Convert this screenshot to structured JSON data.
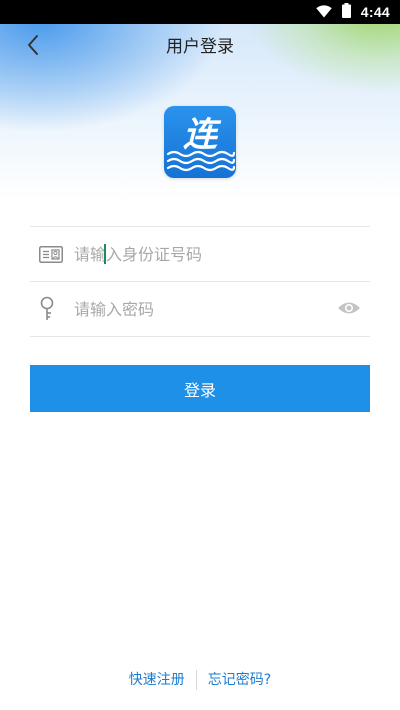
{
  "status_bar": {
    "time": "4:44"
  },
  "header": {
    "title": "用户登录",
    "back_icon": "chevron-left-icon"
  },
  "logo": {
    "character": "连",
    "background_color": "#1e7fe0"
  },
  "form": {
    "id_field": {
      "placeholder": "请输入身份证号码",
      "value": "",
      "icon": "id-card-icon"
    },
    "password_field": {
      "placeholder": "请输入密码",
      "value": "",
      "icon": "key-icon",
      "toggle_icon": "eye-icon"
    },
    "login_label": "登录"
  },
  "footer": {
    "register_label": "快速注册",
    "forgot_label": "忘记密码?"
  },
  "colors": {
    "accent": "#1e90e8",
    "link": "#1d7cd0",
    "divider": "#e6e6e6",
    "placeholder": "#a8a8a8"
  }
}
